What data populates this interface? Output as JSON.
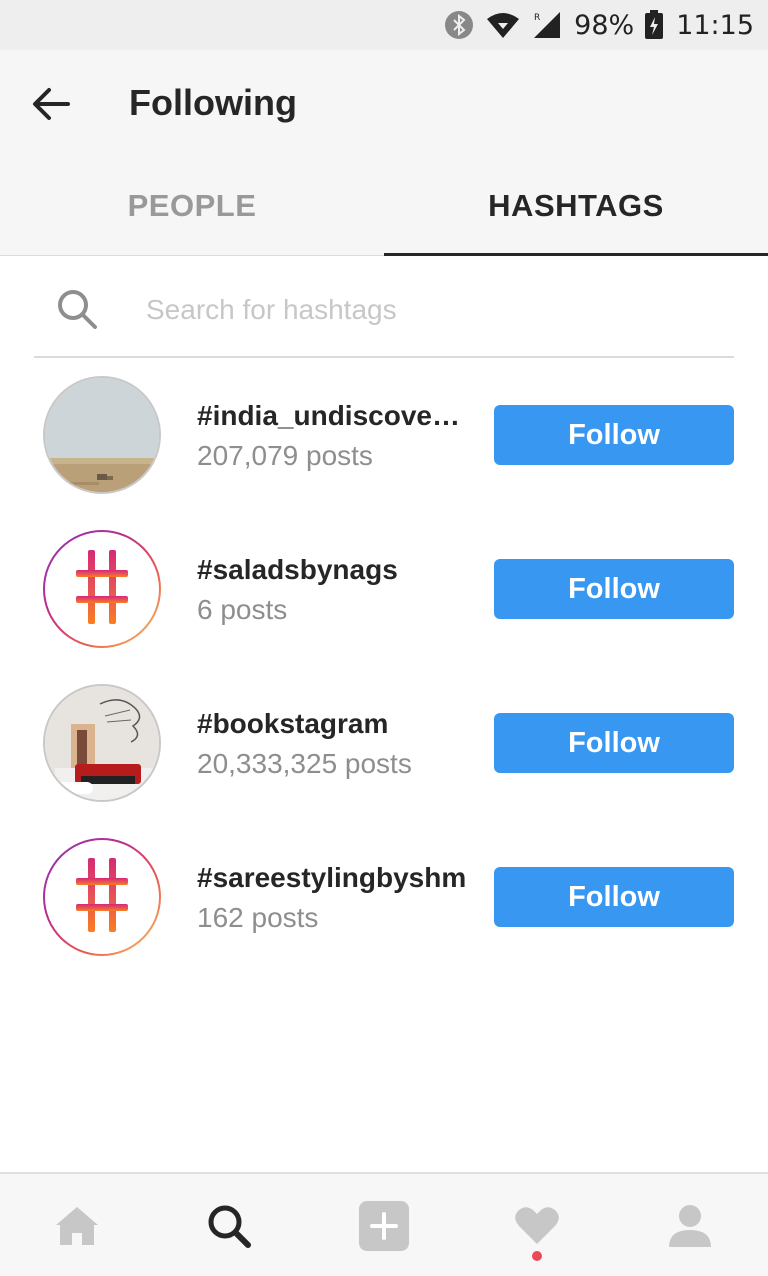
{
  "status_bar": {
    "battery": "98%",
    "time": "11:15",
    "icons": [
      "bluetooth-icon",
      "wifi-icon",
      "signal-icon",
      "battery-charging-icon"
    ]
  },
  "header": {
    "title": "Following",
    "back_icon": "back-arrow-icon"
  },
  "tabs": [
    {
      "label": "PEOPLE",
      "active": false
    },
    {
      "label": "HASHTAGS",
      "active": true
    }
  ],
  "search": {
    "placeholder": "Search for hashtags",
    "value": ""
  },
  "hashtags": [
    {
      "name": "#india_undiscover…",
      "posts": "207,079 posts",
      "button": "Follow",
      "avatar": "photo-desert"
    },
    {
      "name": "#saladsbynags",
      "posts": "6 posts",
      "button": "Follow",
      "avatar": "hashtag-icon"
    },
    {
      "name": "#bookstagram",
      "posts": "20,333,325 posts",
      "button": "Follow",
      "avatar": "photo-typewriter"
    },
    {
      "name": "#sareestylingbyshm",
      "posts": "162 posts",
      "button": "Follow",
      "avatar": "hashtag-icon"
    }
  ],
  "bottom_nav": {
    "items": [
      "home-icon",
      "search-icon",
      "add-post-icon",
      "heart-icon",
      "profile-icon"
    ],
    "active": "search-icon",
    "notification_dot": true
  },
  "colors": {
    "accent": "#3897f0",
    "notification": "#ed4956"
  }
}
